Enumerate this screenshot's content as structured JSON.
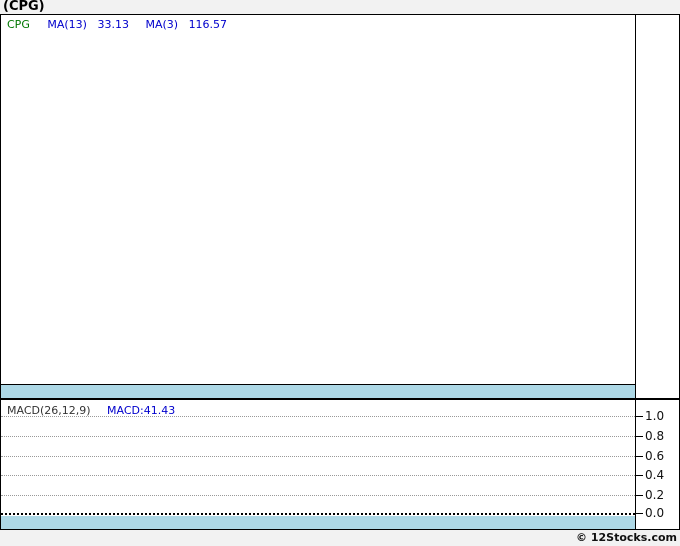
{
  "header": {
    "title": "(CPG)"
  },
  "price_panel": {
    "ticker": "CPG",
    "ma13_label": "MA(13)",
    "ma13_value": "33.13",
    "ma3_label": "MA(3)",
    "ma3_value": "116.57"
  },
  "macd_panel": {
    "label": "MACD(26,12,9)",
    "value_label": "MACD:41.43",
    "yticks": [
      "1.0",
      "0.8",
      "0.6",
      "0.4",
      "0.2",
      "0.0"
    ]
  },
  "footer": {
    "credit": "© 12Stocks.com"
  },
  "colors": {
    "indicator_blue": "#0000cc",
    "ticker_green": "#007700",
    "band_light_blue": "#add8e6",
    "grid_dotted_gray": "#999999",
    "zero_line_black": "#000000",
    "page_background": "#f2f2f2",
    "panel_background": "#ffffff"
  },
  "chart_data": [
    {
      "type": "line",
      "panel": "price",
      "title": "(CPG)",
      "legend_position": "top-left",
      "grid": false,
      "series": [
        {
          "name": "CPG",
          "values": []
        },
        {
          "name": "MA(13)",
          "latest_value": 33.13,
          "values": []
        },
        {
          "name": "MA(3)",
          "latest_value": 116.57,
          "values": []
        }
      ],
      "note": "price panel is rendered empty (no visible plotted points); solid light-blue band along bottom of panel"
    },
    {
      "type": "line",
      "panel": "macd",
      "title": "MACD(26,12,9)",
      "legend_position": "top-left",
      "grid": true,
      "yticks": [
        1.0,
        0.8,
        0.6,
        0.4,
        0.2,
        0.0
      ],
      "ylim": [
        -0.12,
        1.1
      ],
      "series": [
        {
          "name": "MACD",
          "latest_value": 41.43,
          "values": []
        }
      ],
      "note": "no visible MACD line; dotted gray gridlines every 0.2, darker dotted zero line, light-blue band along bottom"
    }
  ]
}
